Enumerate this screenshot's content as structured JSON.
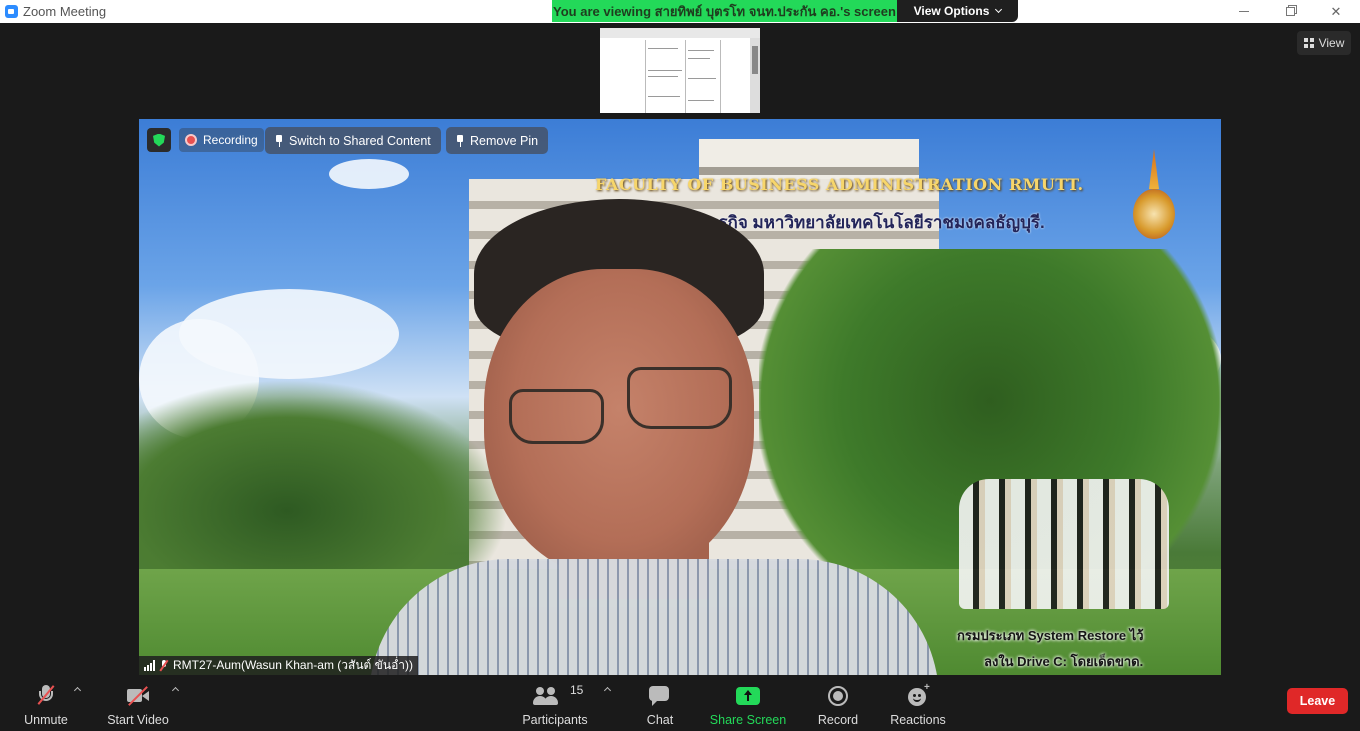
{
  "window": {
    "title": "Zoom Meeting"
  },
  "banner": {
    "viewing_text": "You are viewing สายทิพย์ บุตรโท จนท.ประกัน คอ.'s screen",
    "view_options_label": "View Options"
  },
  "view_button": {
    "label": "View"
  },
  "video_overlay": {
    "recording_label": "Recording",
    "switch_label": "Switch to Shared Content",
    "remove_pin_label": "Remove Pin",
    "participant_name": "RMT27-Aum(Wasun Khan-am (วสันต์ ขันอ่ำ))"
  },
  "background_text": {
    "faculty": "FACULTY OF BUSINESS ADMINISTRATION RMUTT.",
    "thai_line": "ริหารธุรกิจ มหาวิทยาลัยเทคโนโลยีราชมงคลธัญบุรี.",
    "subtitle_line1": "กรมประเภท System Restore ไว้",
    "subtitle_line2": "ลงใน Drive C: โดยเด็ดขาด."
  },
  "toolbar": {
    "unmute_label": "Unmute",
    "start_video_label": "Start Video",
    "participants_label": "Participants",
    "participants_count": "15",
    "chat_label": "Chat",
    "share_screen_label": "Share Screen",
    "record_label": "Record",
    "reactions_label": "Reactions",
    "leave_label": "Leave"
  },
  "colors": {
    "accent_green": "#23d959",
    "leave_red": "#e02828",
    "toolbar_bg": "#1a1a1a"
  }
}
